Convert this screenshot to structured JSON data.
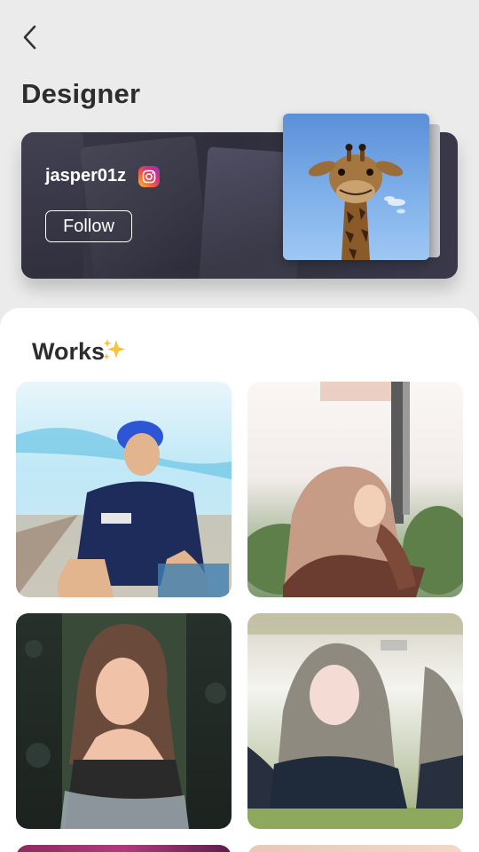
{
  "header": {
    "back_icon": "chevron-left-icon",
    "title": "Designer"
  },
  "designer_card": {
    "username": "jasper01z",
    "social_icon": "instagram-icon",
    "follow_label": "Follow",
    "cover_image": "giraffe-photo"
  },
  "works": {
    "title": "Works",
    "title_icon": "sparkles-icon",
    "items": [
      {
        "image": "portrait-young-man-blue-hair"
      },
      {
        "image": "portrait-woman-hijab-outdoors"
      },
      {
        "image": "portrait-woman-dark-floral-background"
      },
      {
        "image": "portrait-woman-hijab-mirrored-effect"
      },
      {
        "image": "portrait-partial-purple"
      },
      {
        "image": "portrait-partial-peach"
      }
    ]
  },
  "colors": {
    "background": "#ebebeb",
    "card": "#34333f",
    "panel": "#ffffff",
    "text": "#2d2d2d"
  }
}
